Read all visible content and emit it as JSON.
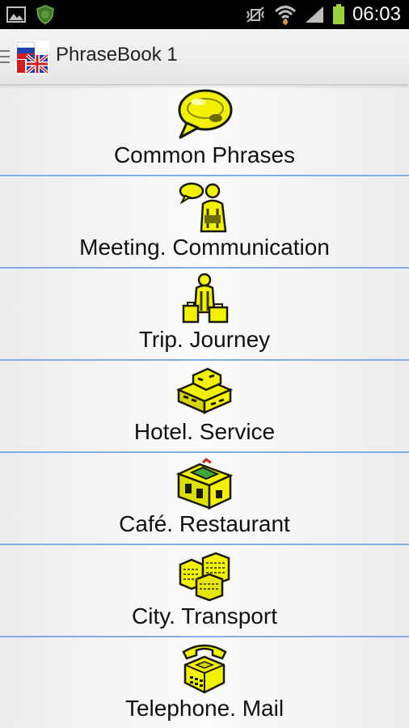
{
  "status_bar": {
    "time": "06:03",
    "icons": [
      "gallery-icon",
      "shield-app-icon",
      "mute-vibrate-icon",
      "wifi-icon",
      "signal-icon",
      "battery-icon"
    ]
  },
  "action_bar": {
    "title": "PhraseBook 1",
    "logo": "flags-logo"
  },
  "categories": [
    {
      "label": "Common Phrases",
      "icon": "speech-bubble-icon"
    },
    {
      "label": "Meeting. Communication",
      "icon": "people-talking-icon"
    },
    {
      "label": "Trip. Journey",
      "icon": "traveler-luggage-icon"
    },
    {
      "label": "Hotel. Service",
      "icon": "hotel-building-icon"
    },
    {
      "label": "Café. Restaurant",
      "icon": "cafe-building-icon"
    },
    {
      "label": "City. Transport",
      "icon": "city-buildings-icon"
    },
    {
      "label": "Telephone. Mail",
      "icon": "telephone-icon"
    }
  ],
  "colors": {
    "icon_yellow": "#f2f200",
    "divider_blue": "#7eaee8",
    "status_bar_bg": "#000000",
    "battery_green": "#9ad43c"
  }
}
